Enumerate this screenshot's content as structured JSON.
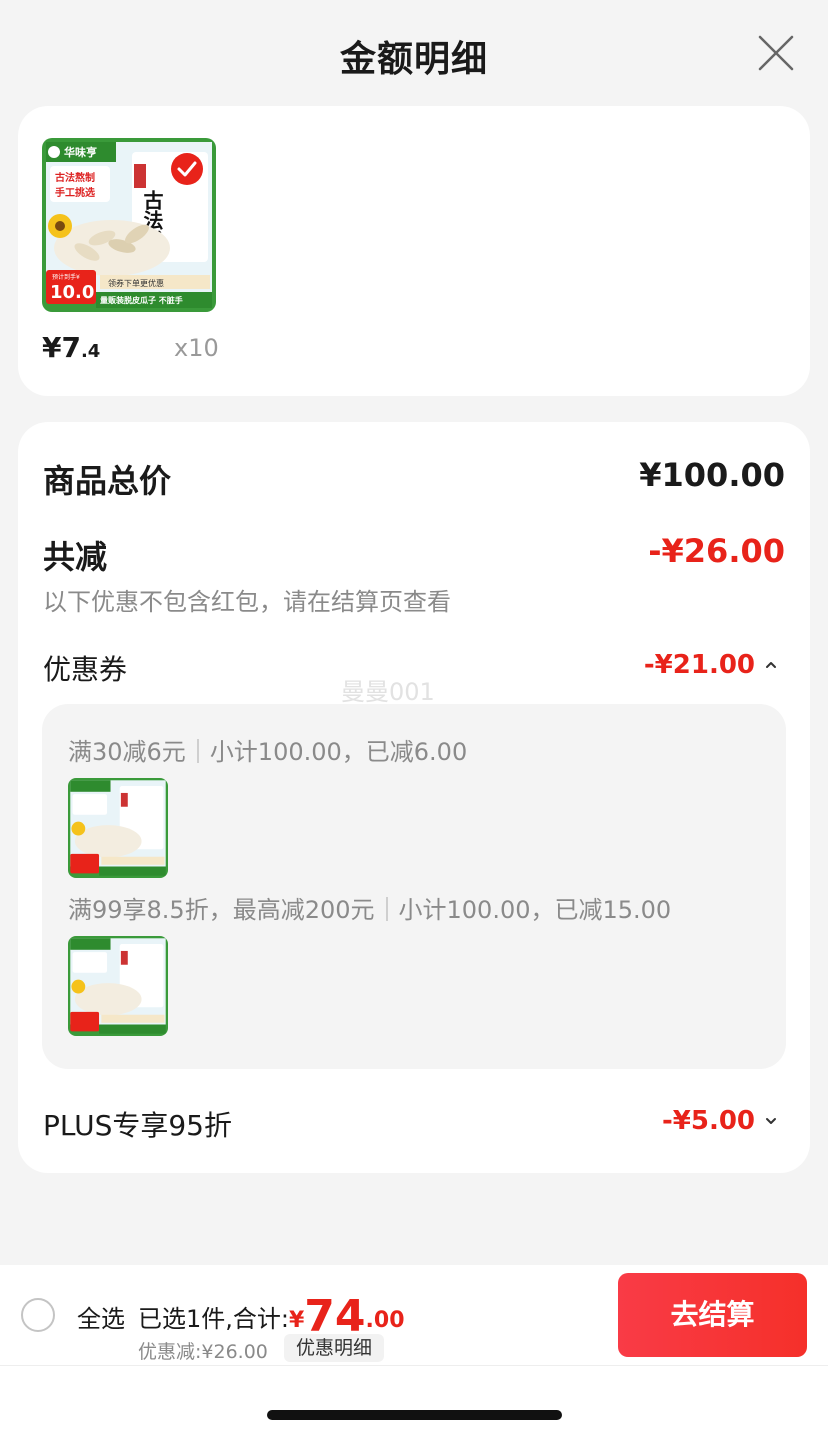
{
  "header": {
    "title": "金额明细"
  },
  "product": {
    "price_main": "¥7",
    "price_cents": ".4",
    "quantity": "x10",
    "image": {
      "brand": "华味亨",
      "badge_line1": "古法熬制",
      "badge_line2": "手工挑选",
      "calligraphy": "古法瓜",
      "price_tag_small": "预计到手¥",
      "price_tag": "10.0",
      "strip1": "领券下单更优惠",
      "strip2": "量贩装脱皮瓜子 不脏手"
    }
  },
  "summary": {
    "total_label": "商品总价",
    "total_value": "¥100.00",
    "reduce_label": "共减",
    "reduce_value": "-¥26.00",
    "note": "以下优惠不包含红包，请在结算页查看",
    "coupon_label": "优惠券",
    "coupon_value": "-¥21.00",
    "watermark": "曼曼001",
    "rules": [
      {
        "condition": "满30减6元",
        "subtotal": "小计100.00，已减6.00"
      },
      {
        "condition": "满99享8.5折，最高减200元",
        "subtotal": "小计100.00，已减15.00"
      }
    ],
    "plus_label": "PLUS专享95折",
    "plus_value": "-¥5.00"
  },
  "bottom": {
    "select_all": "全选",
    "selected_text": "已选1件,合计:",
    "total_symbol": "¥",
    "total_int": "74",
    "total_dec": ".00",
    "discount_text": "优惠减:¥26.00",
    "detail_button": "优惠明细",
    "checkout_button": "去结算"
  },
  "colors": {
    "accent_red": "#e8231a",
    "checkout_gradient": "#f93b46",
    "background": "#f4f4f4"
  },
  "icons": {
    "close": "close-icon",
    "chevron_up": "chevron-up-icon",
    "chevron_down": "chevron-down-icon",
    "check": "check-badge-icon"
  }
}
